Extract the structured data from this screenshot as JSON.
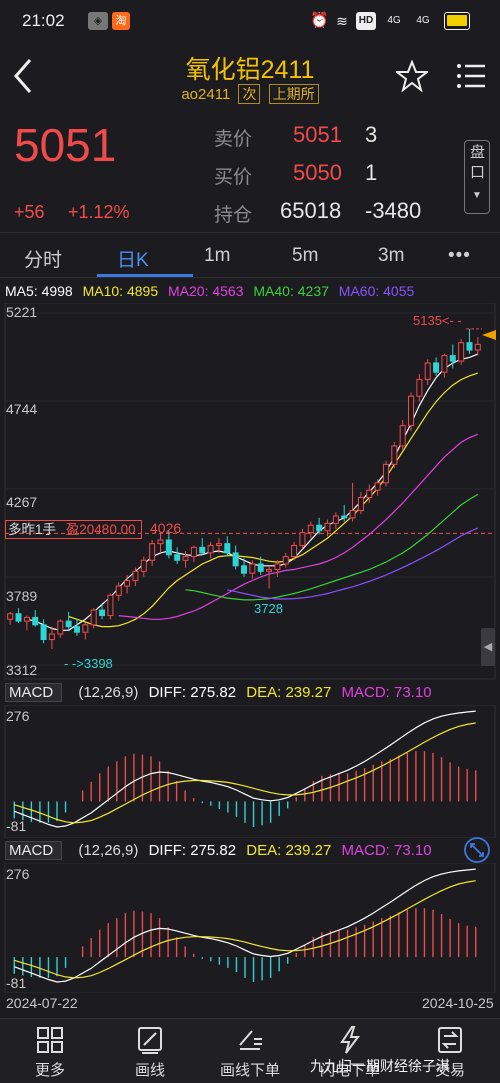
{
  "status": {
    "time": "21:02",
    "signal1": "4G",
    "signal2": "4G",
    "hd": "HD"
  },
  "header": {
    "title": "氧化铝2411",
    "code": "ao2411",
    "tag1": "次",
    "tag2": "上期所"
  },
  "quote": {
    "price": "5051",
    "change": "+56",
    "change_pct": "+1.12%",
    "sell_label": "卖价",
    "sell_price": "5051",
    "sell_vol": "3",
    "buy_label": "买价",
    "buy_price": "5050",
    "buy_vol": "1",
    "oi_label": "持仓",
    "oi_value": "65018",
    "oi_change": "-3480",
    "pankou_label": "盘口"
  },
  "tabs": [
    "分时",
    "日K",
    "1m",
    "5m",
    "3m",
    "•••"
  ],
  "active_tab": "日K",
  "ma_legend": {
    "ma5": "MA5: 4998",
    "ma10": "MA10: 4895",
    "ma20": "MA20: 4563",
    "ma40": "MA40: 4237",
    "ma60": "MA60: 4055"
  },
  "colors": {
    "up": "#f04a4a",
    "down": "#2ed3d3",
    "ma5": "#ffffff",
    "ma10": "#f2e62a",
    "ma20": "#e040e0",
    "ma40": "#3ad03a",
    "ma60": "#8a50ff",
    "accent": "#3a7ae0"
  },
  "annotations": {
    "position_label": "多昨1手",
    "profit_label": "盈20480.00",
    "position_price": "4026",
    "high_label": "5135<- -",
    "low_label": "- ->3398",
    "swing_low_label": "3728"
  },
  "chart_data": [
    {
      "type": "candlestick",
      "y_axis_ticks": [
        "5221",
        "4744",
        "4267",
        "3789",
        "3312"
      ],
      "ylim": [
        3312,
        5221
      ],
      "x_start": "2024-07-22",
      "x_end": "2024-10-25",
      "candles": [
        [
          3560,
          3600,
          3530,
          3590
        ],
        [
          3590,
          3620,
          3540,
          3550
        ],
        [
          3550,
          3580,
          3500,
          3570
        ],
        [
          3570,
          3610,
          3520,
          3530
        ],
        [
          3530,
          3560,
          3430,
          3450
        ],
        [
          3450,
          3520,
          3398,
          3480
        ],
        [
          3480,
          3560,
          3460,
          3550
        ],
        [
          3550,
          3600,
          3500,
          3520
        ],
        [
          3520,
          3560,
          3470,
          3490
        ],
        [
          3490,
          3540,
          3450,
          3530
        ],
        [
          3530,
          3620,
          3510,
          3610
        ],
        [
          3610,
          3640,
          3560,
          3580
        ],
        [
          3580,
          3700,
          3560,
          3690
        ],
        [
          3690,
          3760,
          3660,
          3740
        ],
        [
          3740,
          3800,
          3700,
          3770
        ],
        [
          3770,
          3840,
          3740,
          3820
        ],
        [
          3820,
          3900,
          3790,
          3880
        ],
        [
          3880,
          3990,
          3850,
          3970
        ],
        [
          3970,
          4030,
          3920,
          3990
        ],
        [
          3990,
          4040,
          3890,
          3910
        ],
        [
          3910,
          3950,
          3860,
          3880
        ],
        [
          3880,
          3930,
          3840,
          3900
        ],
        [
          3900,
          3960,
          3870,
          3950
        ],
        [
          3950,
          4000,
          3910,
          3920
        ],
        [
          3920,
          3980,
          3890,
          3960
        ],
        [
          3960,
          4000,
          3920,
          3970
        ],
        [
          3970,
          4010,
          3900,
          3920
        ],
        [
          3920,
          3960,
          3830,
          3850
        ],
        [
          3850,
          3890,
          3790,
          3810
        ],
        [
          3810,
          3880,
          3780,
          3860
        ],
        [
          3860,
          3900,
          3800,
          3820
        ],
        [
          3820,
          3850,
          3728,
          3830
        ],
        [
          3830,
          3880,
          3790,
          3860
        ],
        [
          3860,
          3920,
          3840,
          3900
        ],
        [
          3900,
          3980,
          3880,
          3960
        ],
        [
          3960,
          4050,
          3940,
          4030
        ],
        [
          4030,
          4090,
          4000,
          4070
        ],
        [
          4070,
          4110,
          4020,
          4040
        ],
        [
          4040,
          4100,
          4010,
          4080
        ],
        [
          4080,
          4140,
          4050,
          4120
        ],
        [
          4120,
          4180,
          4090,
          4110
        ],
        [
          4110,
          4300,
          4090,
          4150
        ],
        [
          4150,
          4250,
          4130,
          4220
        ],
        [
          4220,
          4290,
          4190,
          4260
        ],
        [
          4260,
          4320,
          4230,
          4300
        ],
        [
          4300,
          4420,
          4280,
          4400
        ],
        [
          4400,
          4520,
          4380,
          4500
        ],
        [
          4500,
          4640,
          4480,
          4610
        ],
        [
          4610,
          4790,
          4580,
          4770
        ],
        [
          4770,
          4890,
          4740,
          4860
        ],
        [
          4860,
          4970,
          4830,
          4950
        ],
        [
          4950,
          4980,
          4880,
          4900
        ],
        [
          4900,
          5000,
          4870,
          4990
        ],
        [
          4990,
          5050,
          4920,
          4960
        ],
        [
          4960,
          5080,
          4940,
          5060
        ],
        [
          5060,
          5135,
          5000,
          5020
        ],
        [
          5020,
          5090,
          4990,
          5051
        ]
      ],
      "ma_series": {
        "MA5": [
          3560,
          3550,
          3530,
          3510,
          3500,
          3500,
          3530,
          3560,
          3600,
          3640,
          3680,
          3730,
          3780,
          3820,
          3860,
          3900,
          3920,
          3930,
          3920,
          3910,
          3905,
          3910,
          3925,
          3930,
          3920,
          3900,
          3880,
          3860,
          3850,
          3850,
          3850,
          3860,
          3890,
          3940,
          3990,
          4040,
          4070,
          4090,
          4110,
          4150,
          4200,
          4250,
          4300,
          4360,
          4440,
          4530,
          4620,
          4720,
          4800,
          4870,
          4920,
          4950,
          4970,
          4980,
          4998
        ],
        "MA10": [
          3575,
          3560,
          3545,
          3530,
          3520,
          3520,
          3525,
          3540,
          3560,
          3590,
          3630,
          3680,
          3730,
          3770,
          3800,
          3830,
          3860,
          3880,
          3900,
          3905,
          3905,
          3900,
          3895,
          3885,
          3875,
          3870,
          3875,
          3890,
          3910,
          3940,
          3970,
          4000,
          4040,
          4080,
          4120,
          4170,
          4220,
          4270,
          4330,
          4400,
          4470,
          4540,
          4610,
          4680,
          4740,
          4790,
          4830,
          4860,
          4880,
          4895
        ],
        "MA20": [
          3580,
          3575,
          3570,
          3565,
          3560,
          3560,
          3565,
          3575,
          3590,
          3605,
          3625,
          3650,
          3675,
          3700,
          3725,
          3750,
          3770,
          3790,
          3805,
          3815,
          3825,
          3830,
          3840,
          3850,
          3860,
          3875,
          3895,
          3920,
          3950,
          3985,
          4020,
          4060,
          4100,
          4145,
          4190,
          4240,
          4290,
          4340,
          4390,
          4440,
          4480,
          4520,
          4545,
          4563
        ],
        "MA40": [
          3720,
          3715,
          3705,
          3695,
          3685,
          3675,
          3670,
          3665,
          3665,
          3668,
          3672,
          3680,
          3690,
          3700,
          3712,
          3725,
          3740,
          3755,
          3770,
          3785,
          3800,
          3815,
          3830,
          3850,
          3870,
          3895,
          3920,
          3950,
          3985,
          4020,
          4060,
          4100,
          4140,
          4180,
          4210,
          4237
        ],
        "MA60": [
          3720,
          3710,
          3700,
          3690,
          3680,
          3675,
          3670,
          3670,
          3672,
          3676,
          3682,
          3690,
          3700,
          3712,
          3724,
          3736,
          3750,
          3766,
          3782,
          3800,
          3820,
          3840,
          3862,
          3885,
          3908,
          3932,
          3958,
          3985,
          4012,
          4035,
          4055
        ]
      }
    },
    {
      "type": "macd",
      "params": "(12,26,9)",
      "diff_label": "DIFF: 275.82",
      "dea_label": "DEA: 239.27",
      "macd_label": "MACD: 73.10",
      "y_top_label": "276",
      "y_bottom_label": "-81",
      "ylim": [
        -81,
        276
      ],
      "diff": [
        -30,
        -40,
        -50,
        -60,
        -70,
        -78,
        -75,
        -65,
        -50,
        -35,
        -15,
        5,
        25,
        45,
        62,
        75,
        85,
        90,
        88,
        82,
        75,
        68,
        62,
        58,
        52,
        45,
        35,
        22,
        10,
        5,
        2,
        5,
        12,
        25,
        38,
        52,
        65,
        75,
        85,
        95,
        108,
        122,
        138,
        155,
        172,
        190,
        208,
        225,
        240,
        252,
        260,
        266,
        270,
        273,
        275.82
      ],
      "dea": [
        -10,
        -18,
        -26,
        -35,
        -45,
        -55,
        -62,
        -65,
        -63,
        -58,
        -48,
        -36,
        -22,
        -8,
        6,
        20,
        32,
        43,
        52,
        58,
        62,
        64,
        64,
        63,
        61,
        58,
        53,
        47,
        40,
        33,
        27,
        22,
        20,
        20,
        23,
        28,
        35,
        43,
        52,
        62,
        72,
        83,
        95,
        108,
        122,
        136,
        151,
        166,
        181,
        195,
        208,
        220,
        229,
        235,
        239.27
      ],
      "macd": [
        -40,
        -44,
        -48,
        -50,
        -50,
        -46,
        -26,
        0,
        26,
        46,
        66,
        82,
        94,
        106,
        112,
        110,
        106,
        94,
        72,
        48,
        26,
        8,
        -4,
        -10,
        -18,
        -26,
        -36,
        -50,
        -60,
        -56,
        -50,
        -34,
        -16,
        10,
        30,
        48,
        60,
        64,
        66,
        66,
        72,
        78,
        86,
        94,
        100,
        108,
        114,
        118,
        118,
        114,
        104,
        92,
        82,
        76,
        73.1
      ]
    },
    {
      "type": "macd",
      "params": "(12,26,9)",
      "diff_label": "DIFF: 275.82",
      "dea_label": "DEA: 239.27",
      "macd_label": "MACD: 73.10",
      "y_top_label": "276",
      "y_bottom_label": "-81",
      "ylim": [
        -81,
        276
      ],
      "x_start": "2024-07-22",
      "x_end": "2024-10-25"
    }
  ],
  "nav": [
    {
      "icon": "grid-icon",
      "label": "更多"
    },
    {
      "icon": "pen-icon",
      "label": "画线"
    },
    {
      "icon": "pen-list-icon",
      "label": "画线下单"
    },
    {
      "icon": "lightning-icon",
      "label": "闪电下单"
    },
    {
      "icon": "swap-icon",
      "label": "交易"
    }
  ],
  "watermark": "九九归一期财经徐子淇"
}
